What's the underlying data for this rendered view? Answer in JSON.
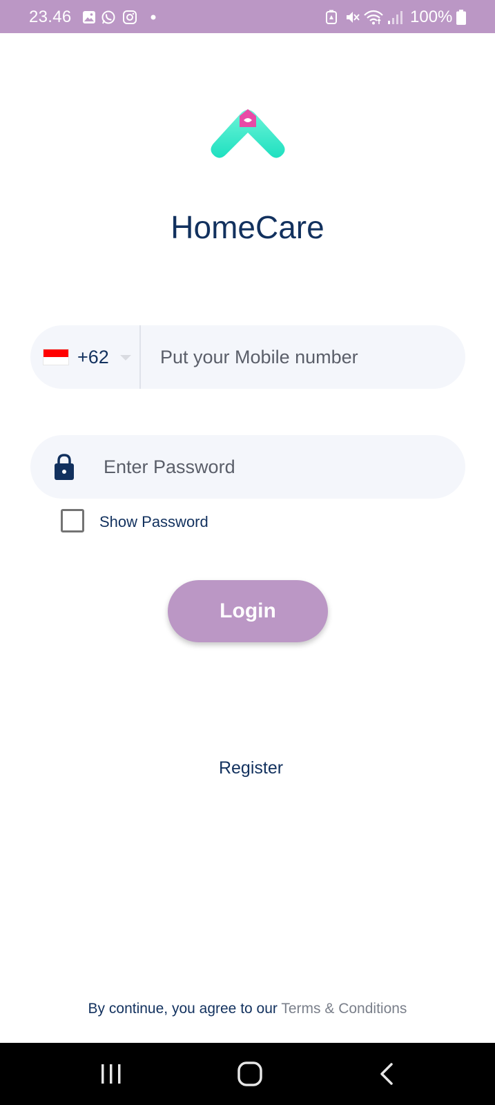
{
  "status_bar": {
    "time": "23.46",
    "battery_text": "100%",
    "left_icons": [
      "gallery-icon",
      "whatsapp-icon",
      "instagram-icon",
      "dot-icon"
    ],
    "right_icons": [
      "battery-saver-icon",
      "mute-icon",
      "wifi-icon",
      "signal-icon",
      "battery-icon"
    ],
    "background": "#bb97c5"
  },
  "app": {
    "logo_icon": "homecare-logo-icon",
    "title": "HomeCare"
  },
  "phone": {
    "country_flag": "indonesia-flag-icon",
    "country_code": "+62",
    "placeholder": "Put your Mobile number",
    "value": ""
  },
  "password": {
    "icon": "lock-icon",
    "placeholder": "Enter Password",
    "value": "",
    "show_password_label": "Show Password",
    "show_password_checked": false
  },
  "actions": {
    "login_label": "Login",
    "register_label": "Register"
  },
  "footer": {
    "terms_prefix": "By continue, you agree to our ",
    "terms_link": "Terms & Conditions"
  },
  "nav_bar": {
    "icons": [
      "recents-icon",
      "home-icon",
      "back-icon"
    ]
  },
  "colors": {
    "primary": "#bb97c5",
    "text": "#12315e",
    "field_bg": "#f4f6fb",
    "logo_gradient": [
      "#5ef3d2",
      "#1fe3c2"
    ],
    "logo_house": "#e84aa6"
  }
}
